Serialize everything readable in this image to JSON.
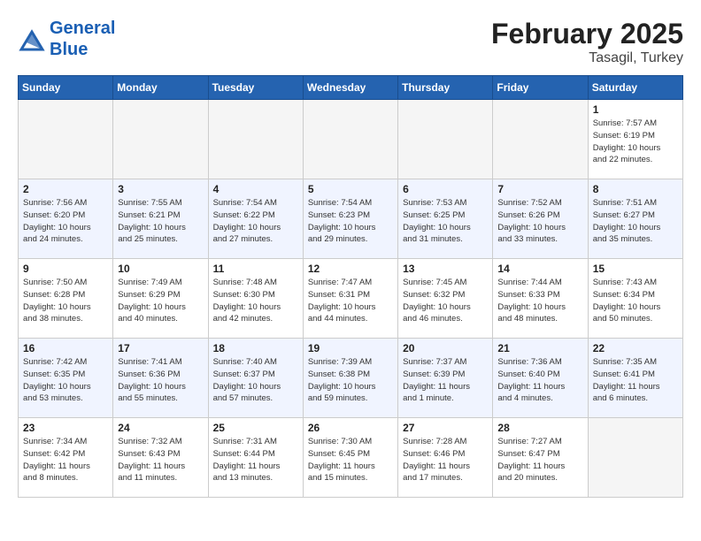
{
  "header": {
    "logo_line1": "General",
    "logo_line2": "Blue",
    "month": "February 2025",
    "location": "Tasagil, Turkey"
  },
  "weekdays": [
    "Sunday",
    "Monday",
    "Tuesday",
    "Wednesday",
    "Thursday",
    "Friday",
    "Saturday"
  ],
  "weeks": [
    [
      {
        "day": "",
        "info": "",
        "empty": true
      },
      {
        "day": "",
        "info": "",
        "empty": true
      },
      {
        "day": "",
        "info": "",
        "empty": true
      },
      {
        "day": "",
        "info": "",
        "empty": true
      },
      {
        "day": "",
        "info": "",
        "empty": true
      },
      {
        "day": "",
        "info": "",
        "empty": true
      },
      {
        "day": "1",
        "info": "Sunrise: 7:57 AM\nSunset: 6:19 PM\nDaylight: 10 hours\nand 22 minutes.",
        "empty": false
      }
    ],
    [
      {
        "day": "2",
        "info": "Sunrise: 7:56 AM\nSunset: 6:20 PM\nDaylight: 10 hours\nand 24 minutes.",
        "empty": false
      },
      {
        "day": "3",
        "info": "Sunrise: 7:55 AM\nSunset: 6:21 PM\nDaylight: 10 hours\nand 25 minutes.",
        "empty": false
      },
      {
        "day": "4",
        "info": "Sunrise: 7:54 AM\nSunset: 6:22 PM\nDaylight: 10 hours\nand 27 minutes.",
        "empty": false
      },
      {
        "day": "5",
        "info": "Sunrise: 7:54 AM\nSunset: 6:23 PM\nDaylight: 10 hours\nand 29 minutes.",
        "empty": false
      },
      {
        "day": "6",
        "info": "Sunrise: 7:53 AM\nSunset: 6:25 PM\nDaylight: 10 hours\nand 31 minutes.",
        "empty": false
      },
      {
        "day": "7",
        "info": "Sunrise: 7:52 AM\nSunset: 6:26 PM\nDaylight: 10 hours\nand 33 minutes.",
        "empty": false
      },
      {
        "day": "8",
        "info": "Sunrise: 7:51 AM\nSunset: 6:27 PM\nDaylight: 10 hours\nand 35 minutes.",
        "empty": false
      }
    ],
    [
      {
        "day": "9",
        "info": "Sunrise: 7:50 AM\nSunset: 6:28 PM\nDaylight: 10 hours\nand 38 minutes.",
        "empty": false
      },
      {
        "day": "10",
        "info": "Sunrise: 7:49 AM\nSunset: 6:29 PM\nDaylight: 10 hours\nand 40 minutes.",
        "empty": false
      },
      {
        "day": "11",
        "info": "Sunrise: 7:48 AM\nSunset: 6:30 PM\nDaylight: 10 hours\nand 42 minutes.",
        "empty": false
      },
      {
        "day": "12",
        "info": "Sunrise: 7:47 AM\nSunset: 6:31 PM\nDaylight: 10 hours\nand 44 minutes.",
        "empty": false
      },
      {
        "day": "13",
        "info": "Sunrise: 7:45 AM\nSunset: 6:32 PM\nDaylight: 10 hours\nand 46 minutes.",
        "empty": false
      },
      {
        "day": "14",
        "info": "Sunrise: 7:44 AM\nSunset: 6:33 PM\nDaylight: 10 hours\nand 48 minutes.",
        "empty": false
      },
      {
        "day": "15",
        "info": "Sunrise: 7:43 AM\nSunset: 6:34 PM\nDaylight: 10 hours\nand 50 minutes.",
        "empty": false
      }
    ],
    [
      {
        "day": "16",
        "info": "Sunrise: 7:42 AM\nSunset: 6:35 PM\nDaylight: 10 hours\nand 53 minutes.",
        "empty": false
      },
      {
        "day": "17",
        "info": "Sunrise: 7:41 AM\nSunset: 6:36 PM\nDaylight: 10 hours\nand 55 minutes.",
        "empty": false
      },
      {
        "day": "18",
        "info": "Sunrise: 7:40 AM\nSunset: 6:37 PM\nDaylight: 10 hours\nand 57 minutes.",
        "empty": false
      },
      {
        "day": "19",
        "info": "Sunrise: 7:39 AM\nSunset: 6:38 PM\nDaylight: 10 hours\nand 59 minutes.",
        "empty": false
      },
      {
        "day": "20",
        "info": "Sunrise: 7:37 AM\nSunset: 6:39 PM\nDaylight: 11 hours\nand 1 minute.",
        "empty": false
      },
      {
        "day": "21",
        "info": "Sunrise: 7:36 AM\nSunset: 6:40 PM\nDaylight: 11 hours\nand 4 minutes.",
        "empty": false
      },
      {
        "day": "22",
        "info": "Sunrise: 7:35 AM\nSunset: 6:41 PM\nDaylight: 11 hours\nand 6 minutes.",
        "empty": false
      }
    ],
    [
      {
        "day": "23",
        "info": "Sunrise: 7:34 AM\nSunset: 6:42 PM\nDaylight: 11 hours\nand 8 minutes.",
        "empty": false
      },
      {
        "day": "24",
        "info": "Sunrise: 7:32 AM\nSunset: 6:43 PM\nDaylight: 11 hours\nand 11 minutes.",
        "empty": false
      },
      {
        "day": "25",
        "info": "Sunrise: 7:31 AM\nSunset: 6:44 PM\nDaylight: 11 hours\nand 13 minutes.",
        "empty": false
      },
      {
        "day": "26",
        "info": "Sunrise: 7:30 AM\nSunset: 6:45 PM\nDaylight: 11 hours\nand 15 minutes.",
        "empty": false
      },
      {
        "day": "27",
        "info": "Sunrise: 7:28 AM\nSunset: 6:46 PM\nDaylight: 11 hours\nand 17 minutes.",
        "empty": false
      },
      {
        "day": "28",
        "info": "Sunrise: 7:27 AM\nSunset: 6:47 PM\nDaylight: 11 hours\nand 20 minutes.",
        "empty": false
      },
      {
        "day": "",
        "info": "",
        "empty": true
      }
    ]
  ]
}
